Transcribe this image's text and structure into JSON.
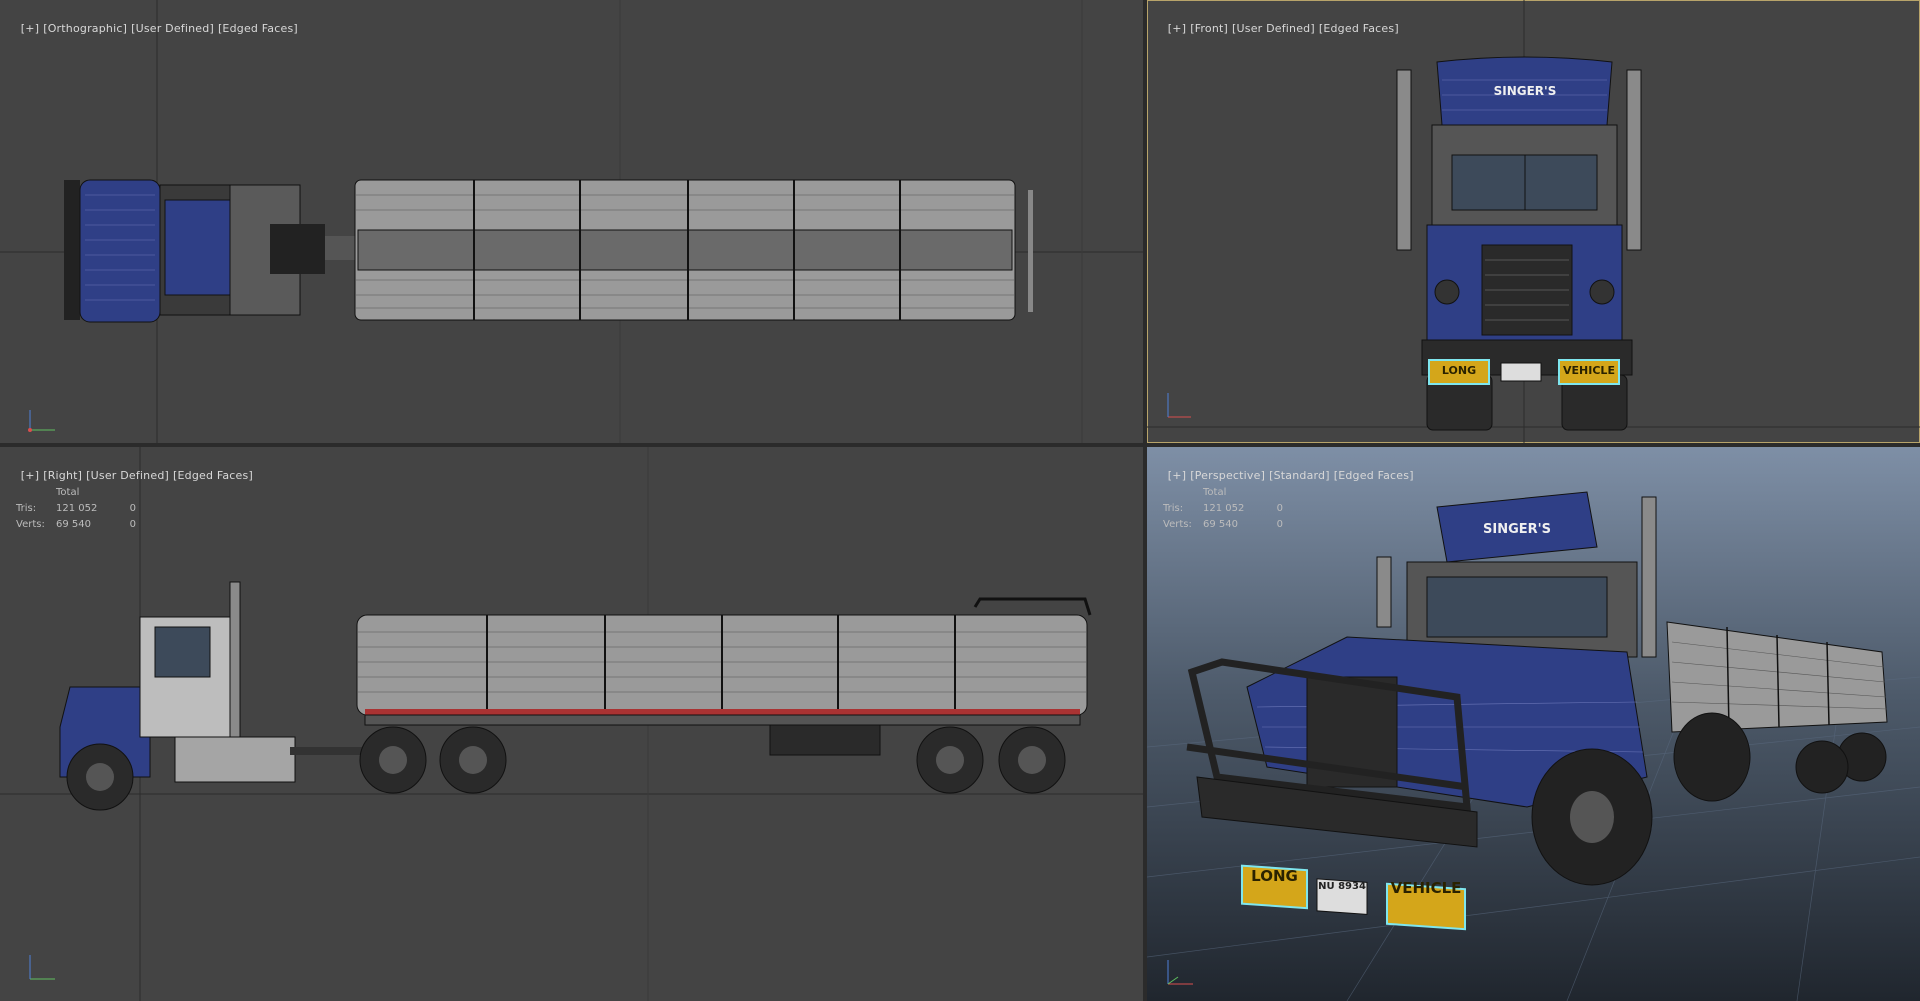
{
  "colors": {
    "viewport_bg": "#444444",
    "divider": "#2a2a2a",
    "active_border": "#b8a46a",
    "grid_line": "#2c2c2c",
    "truck_blue": "#2f3f86",
    "tank_gray": "#9a9a9a",
    "plate_yellow": "#d4a61a",
    "plate_outline": "#7fe6ee"
  },
  "viewports": {
    "top_left": {
      "label_parts": [
        "[+]",
        "[Orthographic]",
        "[User Defined]",
        "[Edged Faces]"
      ]
    },
    "top_right": {
      "label_parts": [
        "[+]",
        "[Front]",
        "[User Defined]",
        "[Edged Faces]"
      ]
    },
    "bottom_left": {
      "label_parts": [
        "[+]",
        "[Right]",
        "[User Defined]",
        "[Edged Faces]"
      ],
      "stats": {
        "header": "Total",
        "tris_label": "Tris:",
        "tris_value": "121 052",
        "tris_selected": "0",
        "verts_label": "Verts:",
        "verts_value": "69 540",
        "verts_selected": "0"
      }
    },
    "bottom_right": {
      "label_parts": [
        "[+]",
        "[Perspective]",
        "[Standard]",
        "[Edged Faces]"
      ],
      "stats": {
        "header": "Total",
        "tris_label": "Tris:",
        "tris_value": "121 052",
        "tris_selected": "0",
        "verts_label": "Verts:",
        "verts_value": "69 540",
        "verts_selected": "0"
      }
    }
  },
  "plates": {
    "left": "LONG",
    "right": "VEHICLE",
    "license": "NU 8934"
  },
  "axis_icon": {
    "x": "x",
    "y": "y",
    "z": "z"
  }
}
